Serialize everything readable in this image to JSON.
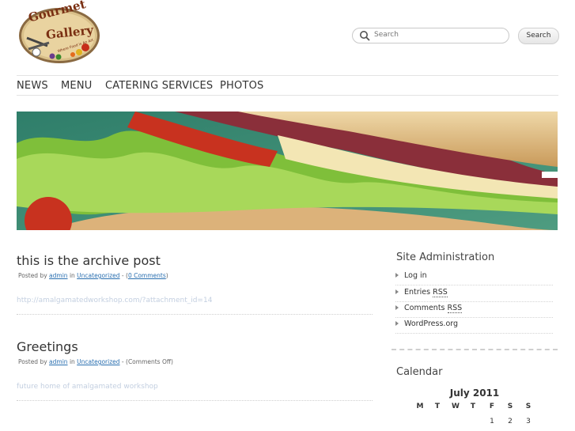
{
  "logo": {
    "line1": "Gourmet",
    "line2": "Gallery",
    "tagline": "Where Food is An Art"
  },
  "search": {
    "placeholder": "Search",
    "button": "Search"
  },
  "nav": [
    "NEWS",
    "MENU",
    "CATERING SERVICES",
    "PHOTOS"
  ],
  "posts": [
    {
      "title": "this is the archive post",
      "posted_by": "Posted by",
      "author": "admin",
      "in": "in",
      "category": "Uncategorized",
      "comments_prefix": "- (",
      "comments": "0 Comments",
      "comments_suffix": ")",
      "body": "http://amalgamatedworkshop.com/?attachment_id=14"
    },
    {
      "title": "Greetings",
      "posted_by": "Posted by",
      "author": "admin",
      "in": "in",
      "category": "Uncategorized",
      "comments_text": "- (Comments Off)",
      "body": "future home of amalgamated workshop"
    }
  ],
  "sidebar": {
    "admin_heading": "Site Administration",
    "admin_items": [
      {
        "text": "Log in"
      },
      {
        "text": "Entries ",
        "abbr": "RSS"
      },
      {
        "text": "Comments ",
        "abbr": "RSS"
      },
      {
        "text": "WordPress.org"
      }
    ],
    "calendar_heading": "Calendar",
    "calendar": {
      "caption": "July 2011",
      "days": [
        "M",
        "T",
        "W",
        "T",
        "F",
        "S",
        "S"
      ],
      "first_row": [
        "",
        "",
        "",
        "",
        "1",
        "2",
        "3"
      ]
    }
  }
}
